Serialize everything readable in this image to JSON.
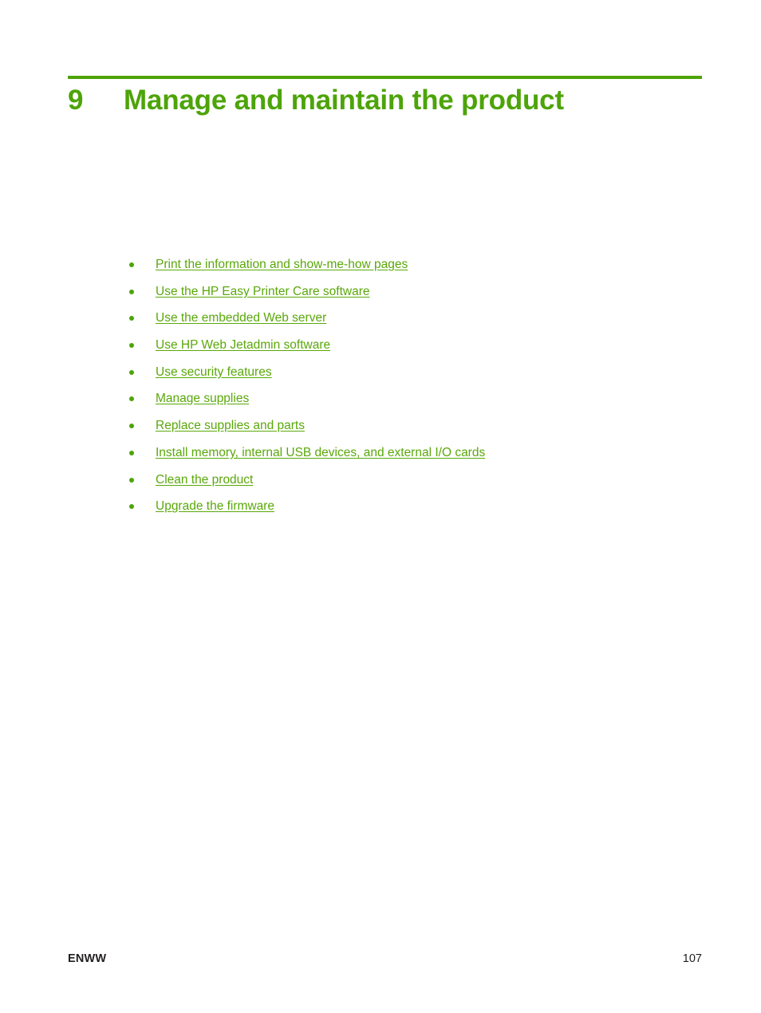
{
  "page": {
    "number": "107",
    "locale_code": "ENWW",
    "background_color": "#ffffff",
    "accent_color": "#4da409",
    "link_color": "#5aa80a",
    "footer_text_color": "#231f20"
  },
  "chapter": {
    "number": "9",
    "title": "Manage and maintain the product"
  },
  "toc": {
    "items": [
      {
        "label": "Print the information and show-me-how pages",
        "bullet": "bullet-dot-icon"
      },
      {
        "label": "Use the HP Easy Printer Care software",
        "bullet": "bullet-dot-icon"
      },
      {
        "label": "Use the embedded Web server",
        "bullet": "bullet-dot-icon"
      },
      {
        "label": "Use HP Web Jetadmin software",
        "bullet": "bullet-dot-icon"
      },
      {
        "label": "Use security features",
        "bullet": "bullet-dot-icon"
      },
      {
        "label": "Manage supplies",
        "bullet": "bullet-dot-icon"
      },
      {
        "label": "Replace supplies and parts",
        "bullet": "bullet-dot-icon"
      },
      {
        "label": "Install memory, internal USB devices, and external I/O cards",
        "bullet": "bullet-dot-icon"
      },
      {
        "label": "Clean the product",
        "bullet": "bullet-dot-icon"
      },
      {
        "label": "Upgrade the firmware",
        "bullet": "bullet-dot-icon"
      }
    ]
  },
  "footer": {
    "left_label": "ENWW",
    "right_label": "107"
  }
}
